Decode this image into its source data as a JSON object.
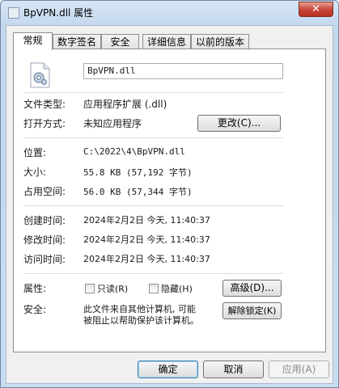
{
  "window": {
    "title": "BpVPN.dll 属性",
    "close_symbol": "✕"
  },
  "tabs": [
    {
      "label": "常规",
      "active": true
    },
    {
      "label": "数字签名",
      "active": false
    },
    {
      "label": "安全",
      "active": false
    },
    {
      "label": "详细信息",
      "active": false
    },
    {
      "label": "以前的版本",
      "active": false
    }
  ],
  "general": {
    "filename": "BpVPN.dll",
    "file_type_label": "文件类型:",
    "file_type_value": "应用程序扩展 (.dll)",
    "open_with_label": "打开方式:",
    "open_with_value": "未知应用程序",
    "change_button": "更改(C)...",
    "location_label": "位置:",
    "location_value": "C:\\2022\\4\\BpVPN.dll",
    "size_label": "大小:",
    "size_value": "55.8 KB (57,192 字节)",
    "disk_size_label": "占用空间:",
    "disk_size_value": "56.0 KB (57,344 字节)",
    "created_label": "创建时间:",
    "created_value": "2024年2月2日 今天, 11:40:37",
    "modified_label": "修改时间:",
    "modified_value": "2024年2月2日 今天, 11:40:37",
    "accessed_label": "访问时间:",
    "accessed_value": "2024年2月2日 今天, 11:40:37",
    "attributes_label": "属性:",
    "readonly_label": "只读(R)",
    "hidden_label": "隐藏(H)",
    "advanced_button": "高级(D)...",
    "security_label": "安全:",
    "security_text_line1": "此文件来自其他计算机, 可能",
    "security_text_line2": "被阻止以帮助保护该计算机。",
    "unblock_button": "解除锁定(K)"
  },
  "footer": {
    "ok": "确定",
    "cancel": "取消",
    "apply": "应用(A)"
  },
  "colors": {
    "accent": "#3c7fb1",
    "close": "#c9463a"
  }
}
